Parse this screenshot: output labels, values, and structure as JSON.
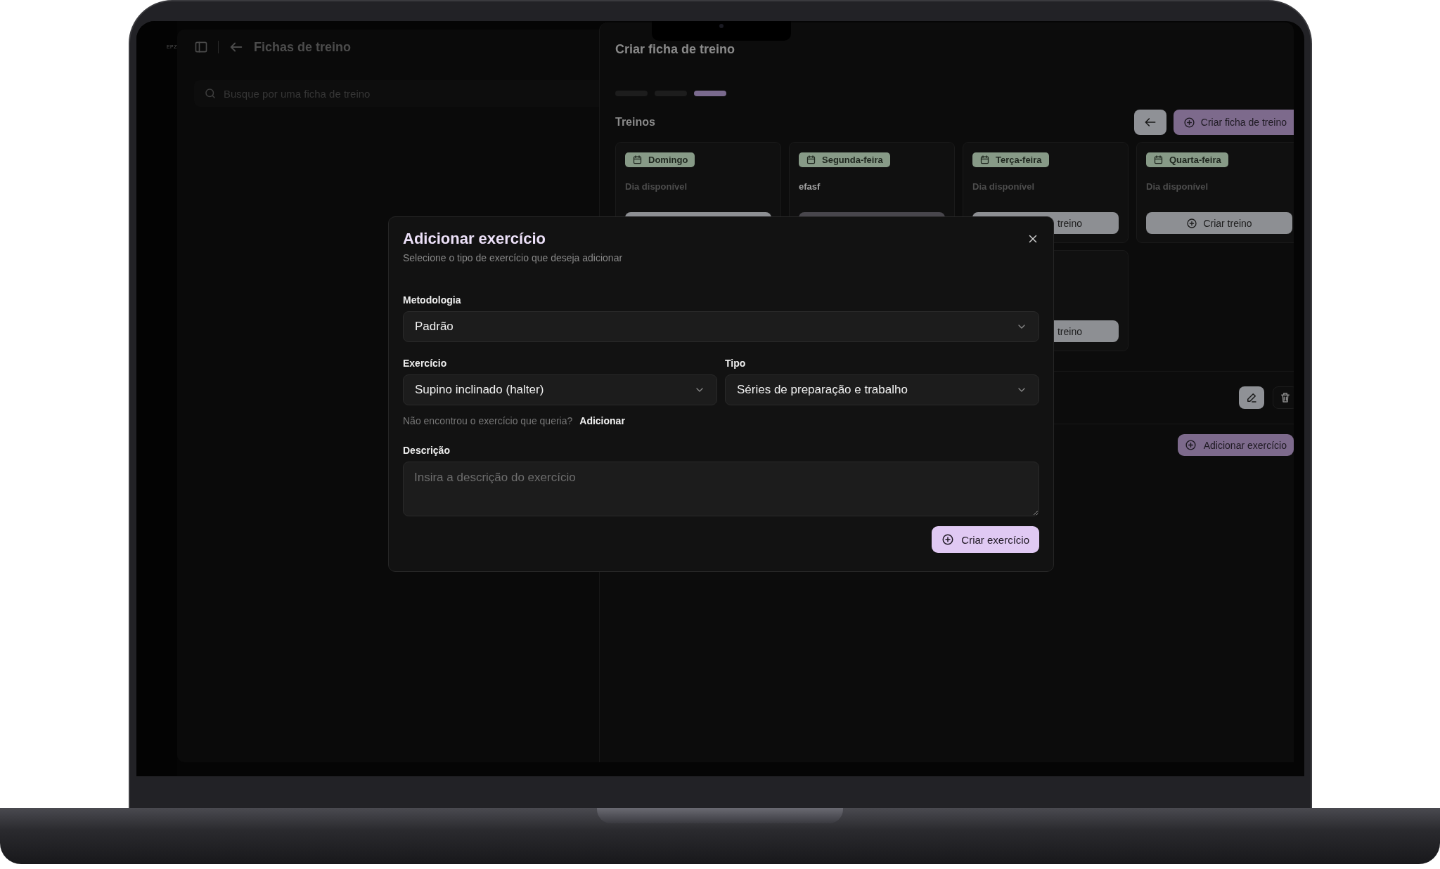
{
  "sidebar": {
    "brand": "EPZ"
  },
  "list_panel": {
    "title": "Fichas de treino",
    "search": {
      "placeholder": "Busque por uma ficha de treino"
    }
  },
  "sheet": {
    "title": "Criar ficha de treino",
    "steps": [
      {
        "selected": false
      },
      {
        "selected": false
      },
      {
        "selected": true
      }
    ],
    "section_title": "Treinos",
    "create_button": "Criar ficha de treino",
    "cards": [
      {
        "day": "Domingo",
        "status": "Dia disponível",
        "available": true,
        "button": {
          "disabled": false
        }
      },
      {
        "day": "Segunda-feira",
        "status": "efasf",
        "available": false,
        "button": {
          "disabled": true
        }
      },
      {
        "day": "Terça-feira",
        "status": "Dia disponível",
        "available": true,
        "button": {
          "label": "treino",
          "icon": false,
          "disabled": false
        }
      },
      {
        "day": "Quarta-feira",
        "status": "Dia disponível",
        "available": true,
        "button": {
          "label": "Criar treino",
          "icon": true,
          "disabled": false
        }
      },
      {
        "button": {
          "label": "treino",
          "icon": false,
          "disabled": false
        }
      }
    ],
    "add_exercise_button": "Adicionar exercício"
  },
  "modal": {
    "title": "Adicionar exercício",
    "subtitle": "Selecione o tipo de exercício que deseja adicionar",
    "fields": [
      {
        "label": "Metodologia",
        "value": "Padrão",
        "wide": true
      },
      {
        "label": "Exercício",
        "value": "Supino inclinado (halter)",
        "wide": false
      },
      {
        "label": "Tipo",
        "value": "Séries de preparação e trabalho",
        "wide": false
      }
    ],
    "hint": {
      "text": "Não encontrou o exercício que queria?",
      "link": "Adicionar"
    },
    "description": {
      "label": "Descrição",
      "placeholder": "Insira a descrição do exercício"
    },
    "submit": "Criar exercício"
  }
}
